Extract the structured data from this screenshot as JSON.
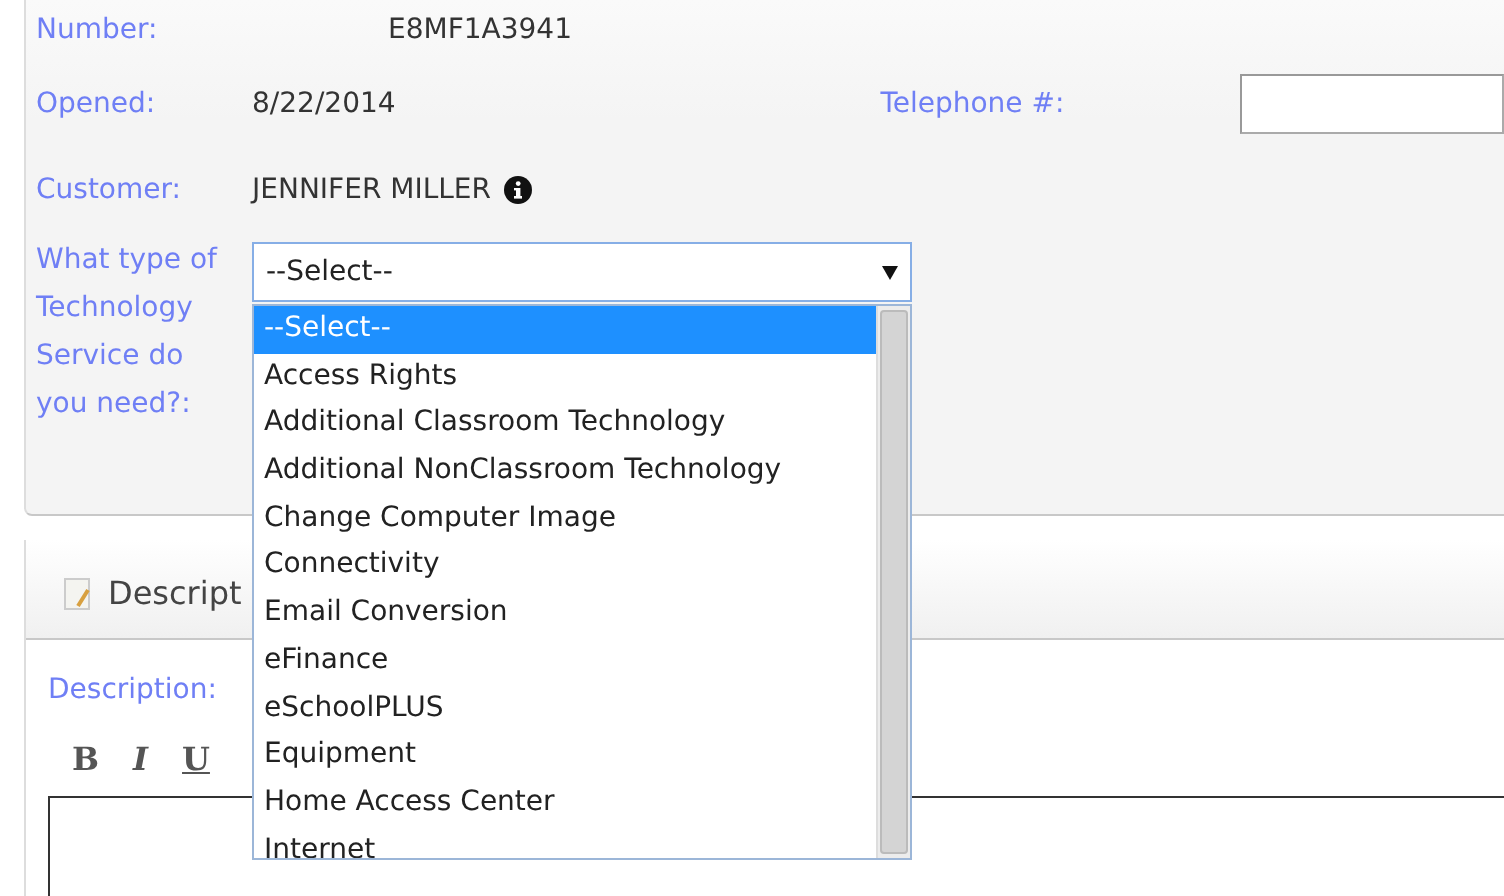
{
  "ticket": {
    "number": {
      "label": "Number:",
      "value": "E8MF1A3941"
    },
    "opened": {
      "label": "Opened:",
      "value": "8/22/2014"
    },
    "telephone": {
      "label": "Telephone #:"
    },
    "customer": {
      "label": "Customer:",
      "value": "JENNIFER MILLER"
    },
    "service": {
      "label": "What type of Technology Service do you need?:",
      "value": "--Select--",
      "expanded": true,
      "options": [
        {
          "label": "--Select--",
          "selected": true
        },
        {
          "label": "Access Rights",
          "selected": false
        },
        {
          "label": "Additional Classroom Technology",
          "selected": false
        },
        {
          "label": "Additional NonClassroom Technology",
          "selected": false
        },
        {
          "label": "Change Computer Image",
          "selected": false
        },
        {
          "label": "Connectivity",
          "selected": false
        },
        {
          "label": "Email Conversion",
          "selected": false
        },
        {
          "label": "eFinance",
          "selected": false
        },
        {
          "label": "eSchoolPLUS",
          "selected": false
        },
        {
          "label": "Equipment",
          "selected": false
        },
        {
          "label": "Home Access Center",
          "selected": false
        },
        {
          "label": "Internet",
          "selected": false
        }
      ]
    }
  },
  "description": {
    "tab": "Descript",
    "label": "Description:",
    "toolbar": [
      {
        "kind": "bold",
        "label": "B"
      },
      {
        "kind": "italic",
        "label": "I"
      },
      {
        "kind": "underline",
        "label": "U"
      }
    ]
  }
}
